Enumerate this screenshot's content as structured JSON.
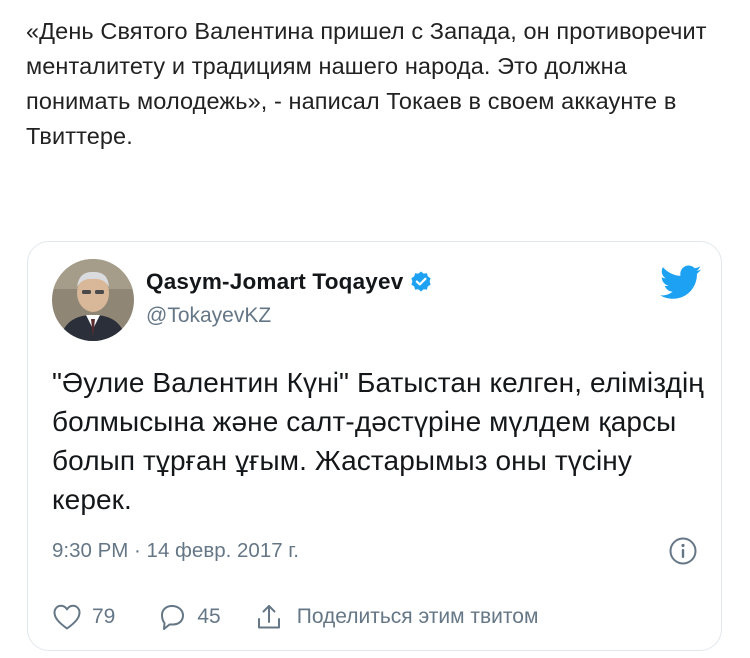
{
  "article": {
    "text": "«День Святого Валентина пришел с Запада, он противоречит менталитету и традициям нашего народа. Это должна понимать молодежь», - написал Токаев в своем аккаунте в Твиттере."
  },
  "tweet": {
    "author_name": "Qasym-Jomart Toqayev",
    "handle": "@TokayevKZ",
    "text": "\"Әулие Валентин Күні\" Батыстан келген, еліміздің болмысына және салт-дәстүріне мүлдем қарсы болып тұрған ұғым. Жастарымыз оны түсіну керек.",
    "timestamp": "9:30 PM · 14 февр. 2017 г.",
    "likes": "79",
    "replies": "45",
    "share_label": "Поделиться этим твитом"
  },
  "icons": {
    "verified": "verified-badge-icon",
    "brand": "twitter-bird-icon",
    "info": "info-icon",
    "like": "heart-icon",
    "reply": "reply-bubble-icon",
    "share": "share-icon"
  },
  "colors": {
    "brand": "#1da1f2",
    "secondary_text": "#657786",
    "primary_text": "#14171a",
    "card_border": "#e1e8ed"
  }
}
